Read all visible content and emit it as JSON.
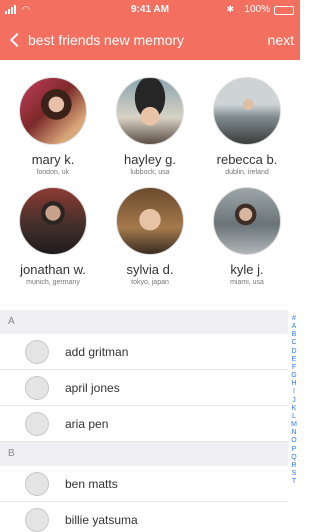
{
  "status": {
    "time": "9:41 AM",
    "battery_pct": "100%",
    "battery_level": 1.0,
    "wifi_icon": "wifi-icon",
    "bluetooth_icon": "bluetooth-icon"
  },
  "nav": {
    "back_label": "best friends",
    "title": "new memory",
    "next_label": "next"
  },
  "friends": [
    {
      "name": "mary k.",
      "location": "london, uk"
    },
    {
      "name": "hayley g.",
      "location": "lubbock, usa"
    },
    {
      "name": "rebecca b.",
      "location": "dublin, ireland"
    },
    {
      "name": "jonathan w.",
      "location": "munich, germany"
    },
    {
      "name": "sylvia d.",
      "location": "tokyo, japan"
    },
    {
      "name": "kyle j.",
      "location": "miami, usa"
    }
  ],
  "contacts": {
    "sections": [
      {
        "letter": "A",
        "items": [
          "add gritman",
          "april jones",
          "aria pen"
        ]
      },
      {
        "letter": "B",
        "items": [
          "ben matts",
          "billie yatsuma"
        ]
      }
    ]
  },
  "index_letters": [
    "#",
    "A",
    "B",
    "C",
    "D",
    "E",
    "F",
    "G",
    "H",
    "I",
    "J",
    "K",
    "L",
    "M",
    "N",
    "O",
    "P",
    "Q",
    "R",
    "S",
    "T"
  ],
  "colors": {
    "accent": "#f36f5f",
    "index_link": "#2f7bf5",
    "section_bg": "#efeff4"
  }
}
